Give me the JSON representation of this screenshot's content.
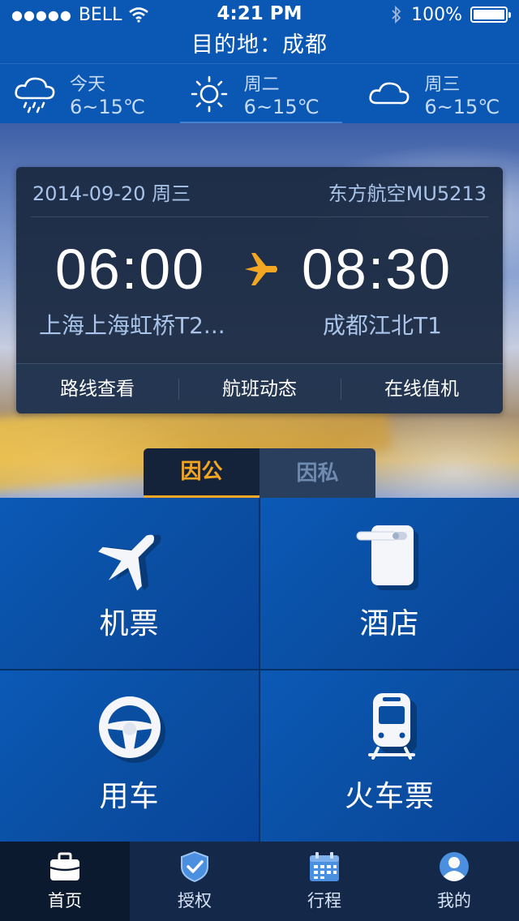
{
  "status_bar": {
    "carrier": "BELL",
    "signal_dots": "●●●●●",
    "time": "4:21 PM",
    "battery": "100%"
  },
  "header": {
    "title": "目的地：成都"
  },
  "weather": [
    {
      "icon": "rain-cloud-icon",
      "day": "今天",
      "temp": "6~15℃"
    },
    {
      "icon": "sun-icon",
      "day": "周二",
      "temp": "6~15℃"
    },
    {
      "icon": "cloud-icon",
      "day": "周三",
      "temp": "6~15℃"
    }
  ],
  "flight": {
    "date": "2014-09-20  周三",
    "flight_no": "东方航空MU5213",
    "dep_time": "06:00",
    "arr_time": "08:30",
    "dep_airport": "上海上海虹桥T2...",
    "arr_airport": "成都江北T1",
    "actions": [
      "路线查看",
      "航班动态",
      "在线值机"
    ]
  },
  "toggle": {
    "active": "因公",
    "inactive": "因私"
  },
  "services": [
    {
      "icon": "airplane-icon",
      "label": "机票"
    },
    {
      "icon": "hotel-door-icon",
      "label": "酒店"
    },
    {
      "icon": "steering-wheel-icon",
      "label": "用车"
    },
    {
      "icon": "train-icon",
      "label": "火车票"
    }
  ],
  "tabbar": [
    {
      "icon": "briefcase-icon",
      "label": "首页"
    },
    {
      "icon": "shield-check-icon",
      "label": "授权"
    },
    {
      "icon": "calendar-icon",
      "label": "行程"
    },
    {
      "icon": "user-icon",
      "label": "我的"
    }
  ],
  "colors": {
    "header_blue": "#0b57b4",
    "accent_orange": "#f2a623",
    "card_bg": "#1b2a42",
    "tile_blue": "#0a4ea2"
  }
}
